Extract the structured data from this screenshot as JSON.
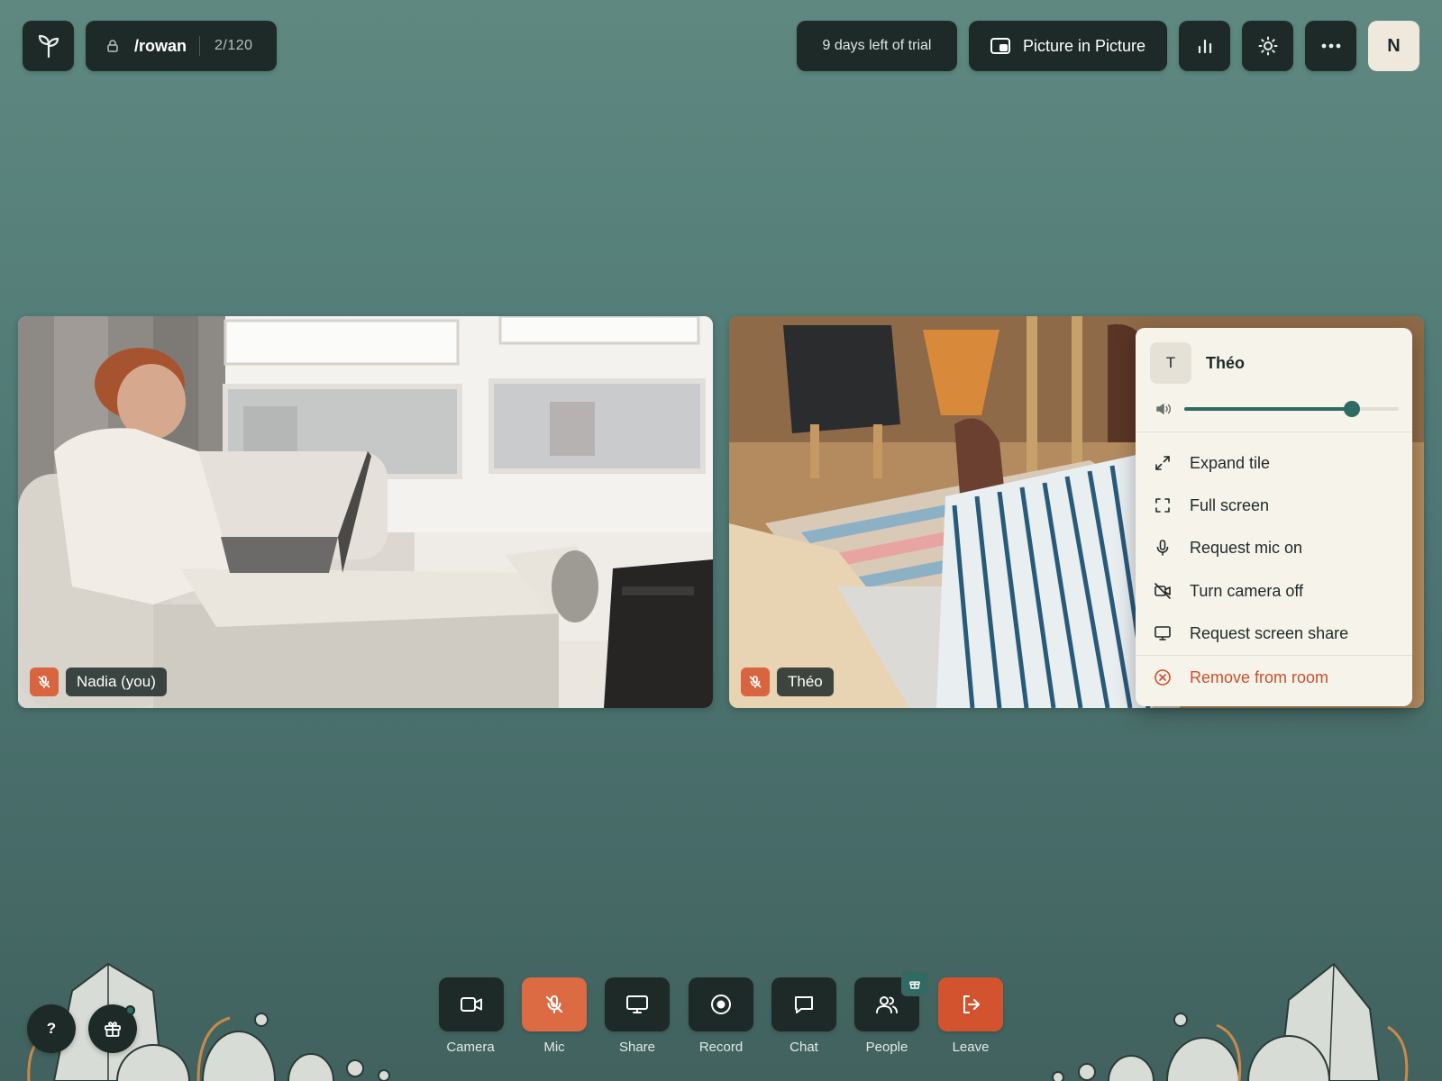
{
  "topbar": {
    "room_name": "/rowan",
    "participant_count": "2/120",
    "trial_text": "9 days left of trial",
    "pip_label": "Picture in Picture",
    "user_initial": "N"
  },
  "tiles": [
    {
      "name": "Nadia (you)",
      "mic_muted": true
    },
    {
      "name": "Théo",
      "mic_muted": true
    }
  ],
  "context_menu": {
    "participant_initial": "T",
    "participant_name": "Théo",
    "volume": 0.78,
    "items": [
      {
        "label": "Expand tile",
        "icon": "expand-icon"
      },
      {
        "label": "Full screen",
        "icon": "fullscreen-icon"
      },
      {
        "label": "Request mic on",
        "icon": "mic-icon"
      },
      {
        "label": "Turn camera off",
        "icon": "camera-off-icon"
      },
      {
        "label": "Request screen share",
        "icon": "monitor-icon"
      }
    ],
    "danger_item": {
      "label": "Remove from room",
      "icon": "remove-circle-icon"
    }
  },
  "toolbar": {
    "camera": "Camera",
    "mic": "Mic",
    "share": "Share",
    "record": "Record",
    "chat": "Chat",
    "people": "People",
    "leave": "Leave"
  },
  "help_label": "?",
  "colors": {
    "accent": "#2e6b62",
    "mic_muted": "#dc6a42",
    "leave": "#d3532f",
    "danger_text": "#c8502e"
  }
}
